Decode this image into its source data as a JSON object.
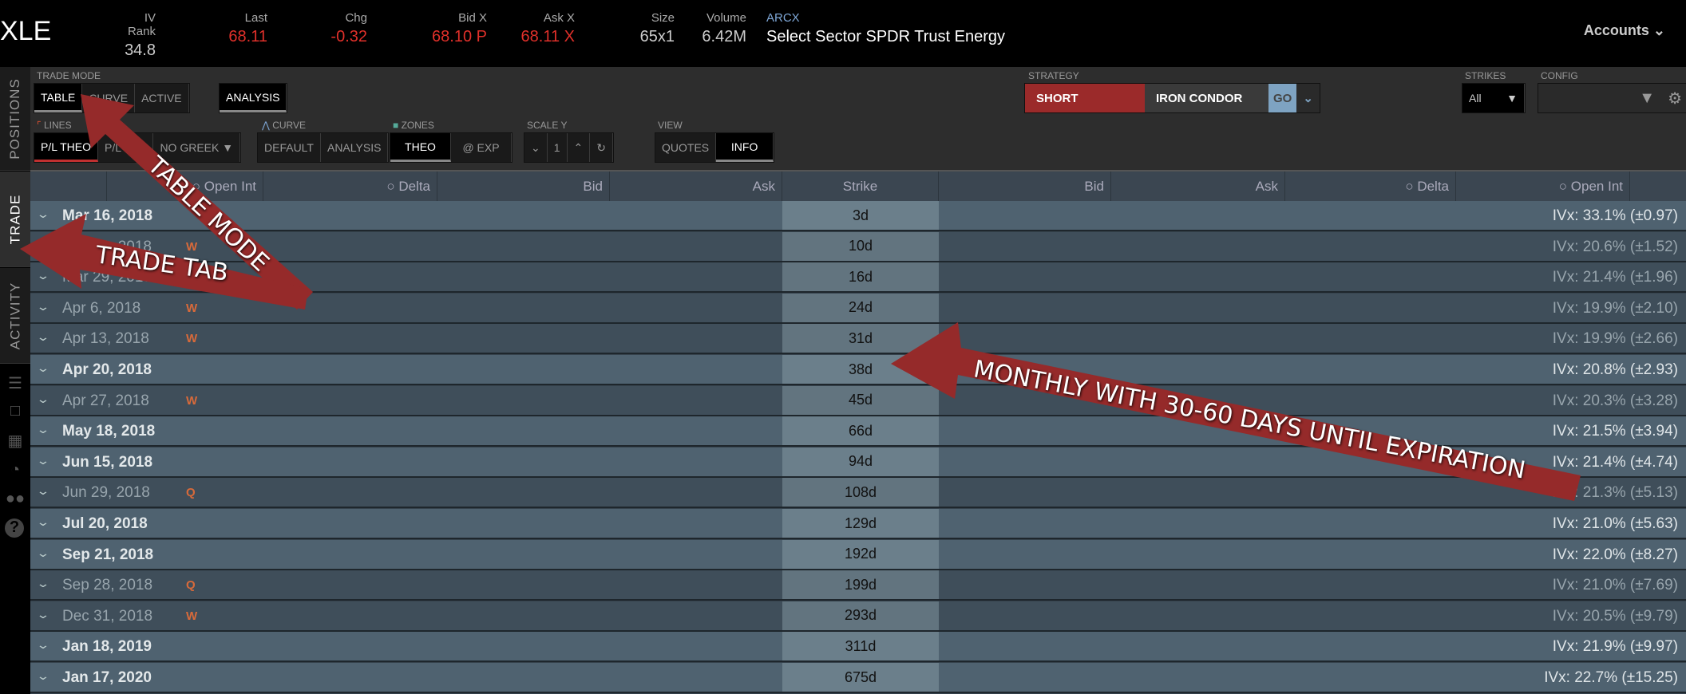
{
  "header": {
    "symbol": "XLE",
    "quotes": [
      {
        "label": "IV Rank",
        "value": "34.8",
        "color": "normal"
      },
      {
        "label": "Last",
        "value": "68.11",
        "color": "red"
      },
      {
        "label": "Chg",
        "value": "-0.32",
        "color": "red"
      },
      {
        "label": "Bid X",
        "value": "68.10 P",
        "color": "red"
      },
      {
        "label": "Ask X",
        "value": "68.11 X",
        "color": "red"
      },
      {
        "label": "Size",
        "value": "65x1",
        "color": "normal"
      },
      {
        "label": "Volume",
        "value": "6.42M",
        "color": "normal"
      }
    ],
    "exchange": "ARCX",
    "description": "Select Sector SPDR Trust Energy",
    "accounts": "Accounts"
  },
  "sidebar": {
    "tabs": [
      "POSITIONS",
      "TRADE",
      "ACTIVITY"
    ],
    "active": "TRADE",
    "icons": [
      "list-icon",
      "tv-icon",
      "chart-icon",
      "dashboard-icon",
      "community-icon",
      "help-icon"
    ]
  },
  "toolbar": {
    "trade_mode": {
      "label": "TRADE MODE",
      "options": [
        "TABLE",
        "CURVE",
        "ACTIVE"
      ],
      "active": "TABLE",
      "analysis": "ANALYSIS"
    },
    "lines": {
      "label": "LINES",
      "options": [
        "P/L THEO",
        "P/L EXP"
      ],
      "greek": "NO GREEK"
    },
    "curve": {
      "label": "CURVE",
      "options": [
        "DEFAULT",
        "ANALYSIS"
      ]
    },
    "zones": {
      "label": "ZONES",
      "options": [
        "THEO",
        "@ EXP"
      ]
    },
    "scale_y": {
      "label": "SCALE Y",
      "value": "1"
    },
    "view": {
      "label": "VIEW",
      "options": [
        "QUOTES",
        "INFO"
      ],
      "active": "INFO"
    },
    "strategy": {
      "label": "STRATEGY",
      "side": "SHORT",
      "type": "IRON CONDOR",
      "go": "GO"
    },
    "strikes": {
      "label": "STRIKES",
      "value": "All"
    },
    "config": {
      "label": "CONFIG"
    }
  },
  "table": {
    "headers_left": [
      "Open Int",
      "Delta",
      "Bid",
      "Ask"
    ],
    "strike_header": "Strike",
    "headers_right": [
      "Bid",
      "Ask",
      "Delta",
      "Open Int"
    ],
    "rows": [
      {
        "date": "Mar 16, 2018",
        "tag": "",
        "days": "3d",
        "ivx": "IVx: 33.1% (±0.97)",
        "monthly": true
      },
      {
        "date": "Mar 23, 2018",
        "tag": "W",
        "days": "10d",
        "ivx": "IVx: 20.6% (±1.52)",
        "monthly": false
      },
      {
        "date": "Mar 29, 2018",
        "tag": "W",
        "days": "16d",
        "ivx": "IVx: 21.4% (±1.96)",
        "monthly": false
      },
      {
        "date": "Apr 6, 2018",
        "tag": "W",
        "days": "24d",
        "ivx": "IVx: 19.9% (±2.10)",
        "monthly": false
      },
      {
        "date": "Apr 13, 2018",
        "tag": "W",
        "days": "31d",
        "ivx": "IVx: 19.9% (±2.66)",
        "monthly": false
      },
      {
        "date": "Apr 20, 2018",
        "tag": "",
        "days": "38d",
        "ivx": "IVx: 20.8% (±2.93)",
        "monthly": true
      },
      {
        "date": "Apr 27, 2018",
        "tag": "W",
        "days": "45d",
        "ivx": "IVx: 20.3% (±3.28)",
        "monthly": false
      },
      {
        "date": "May 18, 2018",
        "tag": "",
        "days": "66d",
        "ivx": "IVx: 21.5% (±3.94)",
        "monthly": true
      },
      {
        "date": "Jun 15, 2018",
        "tag": "",
        "days": "94d",
        "ivx": "IVx: 21.4% (±4.74)",
        "monthly": true
      },
      {
        "date": "Jun 29, 2018",
        "tag": "Q",
        "days": "108d",
        "ivx": "IVx: 21.3% (±5.13)",
        "monthly": false
      },
      {
        "date": "Jul 20, 2018",
        "tag": "",
        "days": "129d",
        "ivx": "IVx: 21.0% (±5.63)",
        "monthly": true
      },
      {
        "date": "Sep 21, 2018",
        "tag": "",
        "days": "192d",
        "ivx": "IVx: 22.0% (±8.27)",
        "monthly": true
      },
      {
        "date": "Sep 28, 2018",
        "tag": "Q",
        "days": "199d",
        "ivx": "IVx: 21.0% (±7.69)",
        "monthly": false
      },
      {
        "date": "Dec 31, 2018",
        "tag": "W",
        "days": "293d",
        "ivx": "IVx: 20.5% (±9.79)",
        "monthly": false
      },
      {
        "date": "Jan 18, 2019",
        "tag": "",
        "days": "311d",
        "ivx": "IVx: 21.9% (±9.97)",
        "monthly": true
      },
      {
        "date": "Jan 17, 2020",
        "tag": "",
        "days": "675d",
        "ivx": "IVx: 22.7% (±15.25)",
        "monthly": true
      }
    ]
  },
  "annotations": {
    "table_mode": "TABLE MODE",
    "trade_tab": "TRADE TAB",
    "monthly": "MONTHLY WITH 30-60 DAYS UNTIL EXPIRATION",
    "color": "#952a2a"
  },
  "colors": {
    "red": "#e0302a",
    "short": "#9b2a2a",
    "go": "#7ea3c2",
    "tag": "#d86a3a"
  }
}
